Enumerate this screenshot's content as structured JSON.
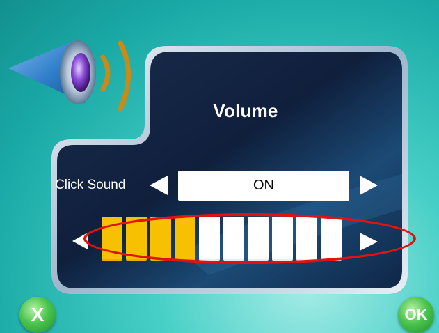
{
  "dialog": {
    "title": "Volume",
    "click_sound": {
      "label": "Click Sound",
      "value": "ON"
    },
    "volume": {
      "level": 4,
      "max": 10
    }
  },
  "buttons": {
    "cancel_label": "X",
    "ok_label": "OK"
  },
  "icons": {
    "speaker": "speaker-icon",
    "left": "left-arrow-icon",
    "right": "right-arrow-icon"
  },
  "colors": {
    "segment_on": "#f7c000",
    "segment_off": "#ffffff",
    "highlight": "#e31212"
  }
}
